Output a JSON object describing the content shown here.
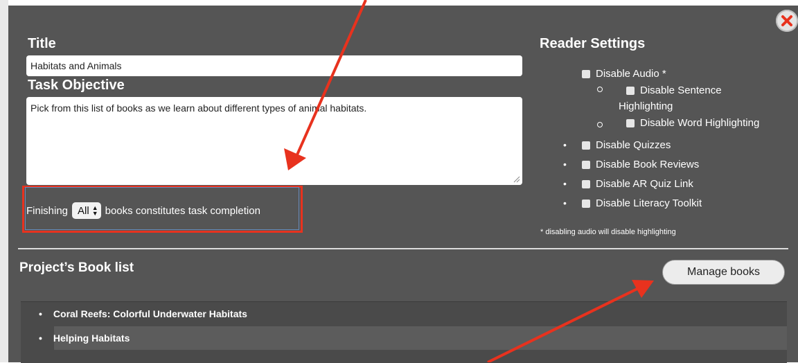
{
  "modal": {
    "title_label": "Title",
    "title_value": "Habitats and Animals",
    "objective_label": "Task Objective",
    "objective_value": "Pick from this list of books as we learn about different types of animal habitats.",
    "completion": {
      "prefix": "Finishing",
      "selected": "All",
      "suffix": "books constitutes task completion"
    }
  },
  "reader_settings": {
    "heading": "Reader Settings",
    "disable_audio": "Disable Audio *",
    "disable_sentence_line1": "Disable Sentence",
    "disable_sentence_line2": "Highlighting",
    "disable_word": "Disable Word Highlighting",
    "disable_quizzes": "Disable Quizzes",
    "disable_reviews": "Disable Book Reviews",
    "disable_ar": "Disable AR Quiz Link",
    "disable_toolkit": "Disable Literacy Toolkit",
    "note": "* disabling audio will disable highlighting"
  },
  "book_list": {
    "heading": "Project’s Book list",
    "manage_label": "Manage books",
    "books": [
      "Coral Reefs: Colorful Underwater Habitats",
      "Helping Habitats"
    ]
  },
  "colors": {
    "modal_bg": "#555555",
    "annotation": "#e8321e",
    "close_icon": "#e8321e"
  },
  "icons": {
    "close": "close-icon",
    "resize": "resize-grip-icon",
    "select_arrows": "updown-chevron-icon"
  }
}
